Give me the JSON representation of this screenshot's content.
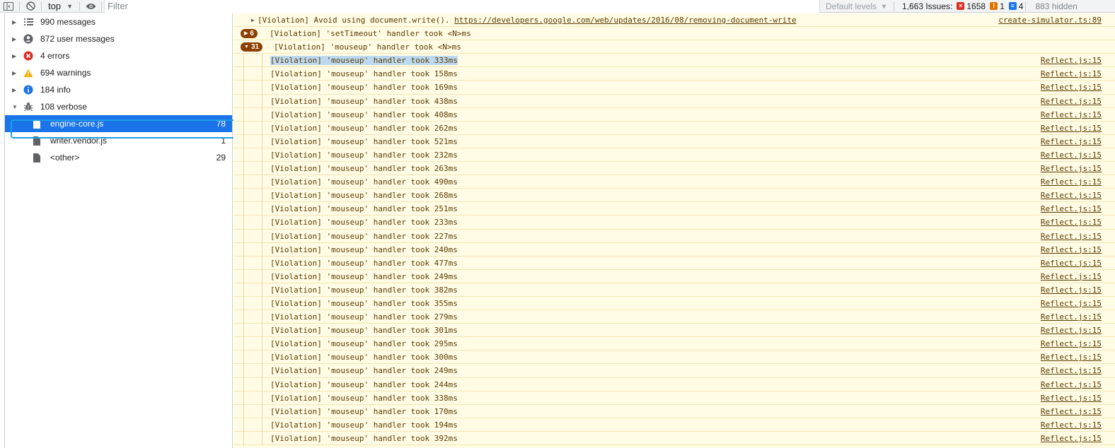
{
  "toolbar": {
    "sidebar_toggle_icon": "sidebar-toggle-icon",
    "clear_icon": "clear-console-icon",
    "context": "top",
    "eye_icon": "eye-icon",
    "filter_placeholder": "Filter",
    "levels_label": "Default levels",
    "issues_label": "1,663 Issues:",
    "errors_count": "1658",
    "warnings_count": "1",
    "info_count": "4",
    "hidden_label": "883 hidden"
  },
  "sidebar": {
    "items": [
      {
        "label": "990 messages",
        "icon": "list-icon"
      },
      {
        "label": "872 user messages",
        "icon": "user-icon"
      },
      {
        "label": "4 errors",
        "icon": "error-icon"
      },
      {
        "label": "694 warnings",
        "icon": "warning-icon"
      },
      {
        "label": "184 info",
        "icon": "info-icon"
      },
      {
        "label": "108 verbose",
        "icon": "bug-icon"
      }
    ],
    "children": [
      {
        "label": "engine-core.js",
        "count": "78"
      },
      {
        "label": "writer.vendor.js",
        "count": "1"
      },
      {
        "label": "<other>",
        "count": "29"
      }
    ]
  },
  "console": {
    "doc_write": {
      "text": "[Violation] Avoid using document.write(). ",
      "link": "https://developers.google.com/web/updates/2016/08/removing-document-write",
      "source": "create-simulator.ts:89"
    },
    "group1": {
      "count": "6",
      "text": "[Violation] 'setTimeout' handler took <N>ms"
    },
    "group2": {
      "count": "31",
      "text": "[Violation] 'mouseup' handler took <N>ms"
    },
    "source": "Reflect.js:15",
    "rows": [
      "[Violation] 'mouseup' handler took 333ms",
      "[Violation] 'mouseup' handler took 158ms",
      "[Violation] 'mouseup' handler took 169ms",
      "[Violation] 'mouseup' handler took 438ms",
      "[Violation] 'mouseup' handler took 408ms",
      "[Violation] 'mouseup' handler took 262ms",
      "[Violation] 'mouseup' handler took 521ms",
      "[Violation] 'mouseup' handler took 232ms",
      "[Violation] 'mouseup' handler took 263ms",
      "[Violation] 'mouseup' handler took 490ms",
      "[Violation] 'mouseup' handler took 268ms",
      "[Violation] 'mouseup' handler took 251ms",
      "[Violation] 'mouseup' handler took 233ms",
      "[Violation] 'mouseup' handler took 227ms",
      "[Violation] 'mouseup' handler took 240ms",
      "[Violation] 'mouseup' handler took 477ms",
      "[Violation] 'mouseup' handler took 249ms",
      "[Violation] 'mouseup' handler took 382ms",
      "[Violation] 'mouseup' handler took 355ms",
      "[Violation] 'mouseup' handler took 279ms",
      "[Violation] 'mouseup' handler took 301ms",
      "[Violation] 'mouseup' handler took 295ms",
      "[Violation] 'mouseup' handler took 300ms",
      "[Violation] 'mouseup' handler took 249ms",
      "[Violation] 'mouseup' handler took 244ms",
      "[Violation] 'mouseup' handler took 338ms",
      "[Violation] 'mouseup' handler took 170ms",
      "[Violation] 'mouseup' handler took 194ms",
      "[Violation] 'mouseup' handler took 392ms"
    ]
  }
}
